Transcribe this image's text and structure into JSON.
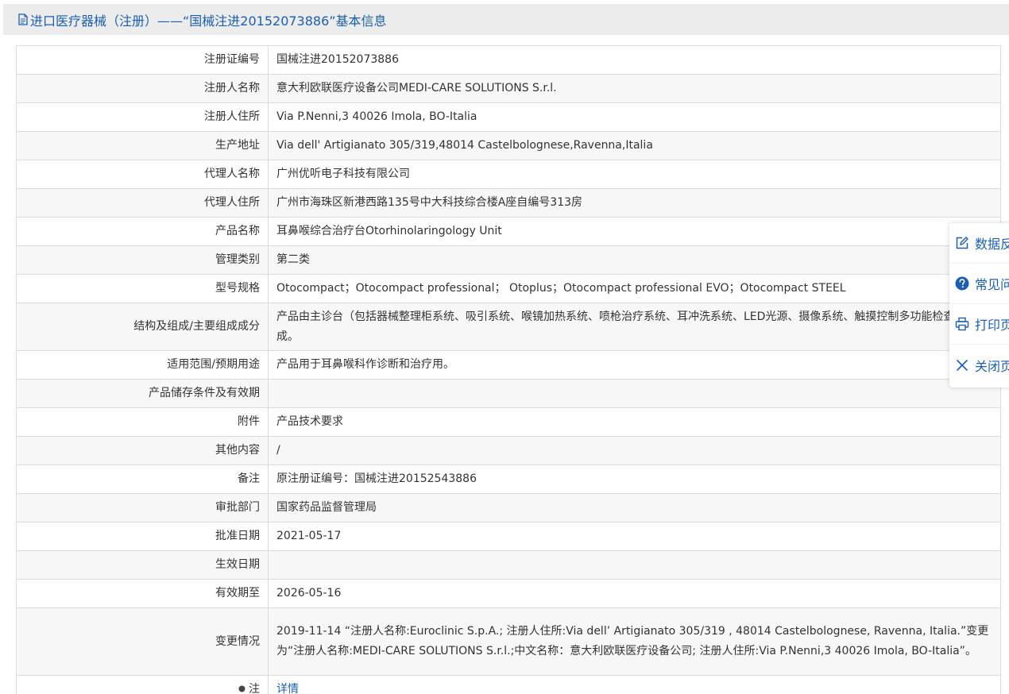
{
  "header": {
    "title": "进口医疗器械（注册）——“国械注进20152073886”基本信息"
  },
  "rows": [
    {
      "label": "注册证编号",
      "value": "国械注进20152073886"
    },
    {
      "label": "注册人名称",
      "value": "意大利欧联医疗设备公司MEDI-CARE SOLUTIONS S.r.l."
    },
    {
      "label": "注册人住所",
      "value": "Via P.Nenni,3 40026 Imola, BO-Italia"
    },
    {
      "label": "生产地址",
      "value": "Via dell' Artigianato 305/319,48014 Castelbolognese,Ravenna,Italia"
    },
    {
      "label": "代理人名称",
      "value": "广州优听电子科技有限公司"
    },
    {
      "label": "代理人住所",
      "value": "广州市海珠区新港西路135号中大科技综合楼A座自编号313房"
    },
    {
      "label": "产品名称",
      "value": "耳鼻喉综合治疗台Otorhinolaringology Unit"
    },
    {
      "label": "管理类别",
      "value": "第二类"
    },
    {
      "label": "型号规格",
      "value": "Otocompact；Otocompact professional； Otoplus；Otocompact professional EVO；Otocompact STEEL"
    },
    {
      "label": "结构及组成/主要组成成分",
      "value": "产品由主诊台（包括器械整理柜系统、吸引系统、喉镜加热系统、喷枪治疗系统、耳冲洗系统、LED光源、摄像系统、触摸控制多功能检查椅组成。"
    },
    {
      "label": "适用范围/预期用途",
      "value": "产品用于耳鼻喉科作诊断和治疗用。"
    },
    {
      "label": "产品储存条件及有效期",
      "value": ""
    },
    {
      "label": "附件",
      "value": "产品技术要求"
    },
    {
      "label": "其他内容",
      "value": "/"
    },
    {
      "label": "备注",
      "value": "原注册证编号：国械注进20152543886"
    },
    {
      "label": "审批部门",
      "value": "国家药品监督管理局"
    },
    {
      "label": "批准日期",
      "value": "2021-05-17"
    },
    {
      "label": "生效日期",
      "value": ""
    },
    {
      "label": "有效期至",
      "value": "2026-05-16"
    },
    {
      "label": "变更情况",
      "value": "2019-11-14 “注册人名称:Euroclinic S.p.A.; 注册人住所:Via dell’ Artigianato 305/319 , 48014 Castelbolognese, Ravenna, Italia.”变更为“注册人名称:MEDI-CARE SOLUTIONS S.r.l.;中文名称：意大利欧联医疗设备公司; 注册人住所:Via P.Nenni,3 40026 Imola, BO-Italia”。"
    }
  ],
  "note_row": {
    "label": "注",
    "link": "详情"
  },
  "side_panel": {
    "items": [
      {
        "label": "数据反馈",
        "icon": "edit-icon"
      },
      {
        "label": "常见问题",
        "icon": "question-icon"
      },
      {
        "label": "打印页面",
        "icon": "print-icon"
      },
      {
        "label": "关闭页面",
        "icon": "close-icon"
      }
    ]
  },
  "colors": {
    "accent": "#1a5fb4",
    "header_bg": "#ececec",
    "row_alt": "#f7f7f7",
    "border": "#dcdcdc"
  }
}
